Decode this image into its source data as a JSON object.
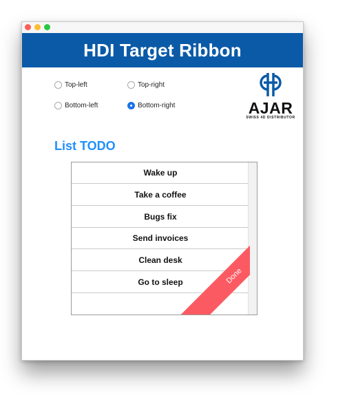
{
  "window": {
    "header_title": "HDI Target Ribbon"
  },
  "positions": {
    "options": [
      {
        "label": "Top-left",
        "selected": false
      },
      {
        "label": "Top-right",
        "selected": false
      },
      {
        "label": "Bottom-left",
        "selected": false
      },
      {
        "label": "Bottom-right",
        "selected": true
      }
    ]
  },
  "logo": {
    "icon": "ajar-logo-icon",
    "word": "AJAR",
    "sub": "SWISS 4D DISTRIBUTOR"
  },
  "list": {
    "title": "List TODO",
    "items": [
      "Wake up",
      "Take a coffee",
      "Bugs fix",
      "Send invoices",
      "Clean desk",
      "Go to sleep"
    ],
    "ribbon_label": "Done"
  },
  "colors": {
    "header": "#0b5aa8",
    "accent": "#1e90ff",
    "ribbon": "#fc5a62"
  }
}
